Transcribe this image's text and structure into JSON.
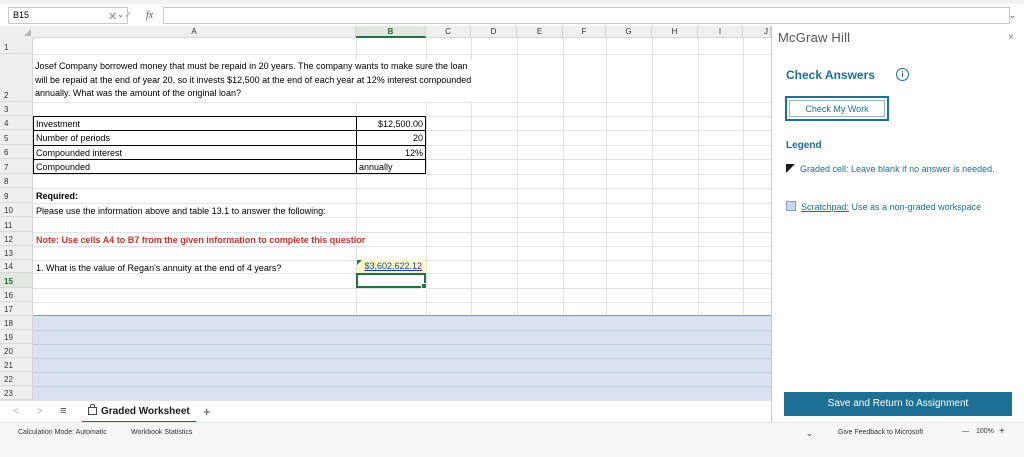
{
  "formula_bar": {
    "name_box": "B15",
    "fx_label": "fx",
    "formula_value": ""
  },
  "columns": [
    "A",
    "B",
    "C",
    "D",
    "E",
    "F",
    "G",
    "H",
    "I",
    "J"
  ],
  "rows": [
    "1",
    "2",
    "3",
    "4",
    "5",
    "6",
    "7",
    "8",
    "9",
    "10",
    "11",
    "12",
    "13",
    "14",
    "15",
    "16",
    "17",
    "18",
    "19",
    "20",
    "21",
    "22",
    "23"
  ],
  "selected": {
    "column": "B",
    "row": "15"
  },
  "cells": {
    "problem_text": "Josef Company borrowed money that must be repaid in 20 years. The company wants to make sure the loan will be repaid at the end of year 20, so it invests $12,500 at the end of each year at 12% interest compounded annually. What was the amount of the original loan?",
    "a4": "Investment",
    "b4": "$12,500.00",
    "a5": "Number of periods",
    "b5": "20",
    "a6": "Compounded interest",
    "b6": "12%",
    "a7": "Compounded",
    "b7": "annually",
    "a9": "Required:",
    "a10": "Please use the information above and table 13.1 to answer the following:",
    "a12": "Note:  Use cells A4 to B7 from the given information to complete this questior",
    "a14": "1. What is the value of Regan's annuity at the end of 4 years?",
    "b14": "$3,602,622.12"
  },
  "sheet_tabs": {
    "active": "Graded Worksheet",
    "add": "+",
    "menu": "≡",
    "prev": "<",
    "next": ">"
  },
  "status_bar": {
    "calc_mode": "Calculation Mode: Automatic",
    "stats": "Workbook Statistics",
    "feedback": "Give Feedback to Microsoft",
    "zoom_minus": "—",
    "zoom": "100%",
    "zoom_plus": "+"
  },
  "panel": {
    "brand": "McGraw Hill",
    "close": "×",
    "check_answers": "Check Answers",
    "info": "i",
    "check_my_work": "Check My Work",
    "legend_title": "Legend",
    "graded_cell": "Graded cell: Leave blank if no answer is needed.",
    "scratchpad_label": "Scratchpad:",
    "scratchpad_desc": " Use as a non-graded workspace",
    "save_return": "Save and Return to Assignment"
  },
  "colors": {
    "accent": "#1d6f94",
    "excel_green": "#217346",
    "answer_fill": "#fcf9c6",
    "scratch_fill": "#d9e1f2"
  }
}
